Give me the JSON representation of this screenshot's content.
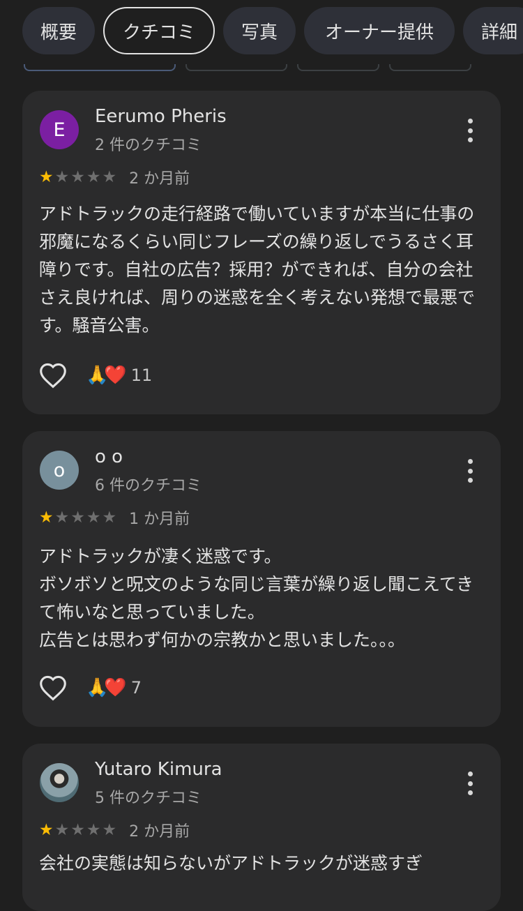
{
  "tabs": [
    {
      "label": "概要"
    },
    {
      "label": "クチコミ"
    },
    {
      "label": "写真"
    },
    {
      "label": "オーナー提供"
    },
    {
      "label": "詳細"
    }
  ],
  "reviews": [
    {
      "name": "Eerumo Pheris",
      "avatar_letter": "E",
      "avatar_color": "#7b1fa2",
      "review_count": "2 件のクチコミ",
      "rating": 1,
      "time": "2 か月前",
      "text": "アドトラックの走行経路で働いていますが本当に仕事の邪魔になるくらい同じフレーズの繰り返しでうるさく耳障りです。自社の広告？採用？ができれば、自分の会社さえ良ければ、周りの迷惑を全く考えない発想で最悪です。騒音公害。",
      "reactions": "🙏❤️",
      "reaction_count": "11"
    },
    {
      "name": "o o",
      "avatar_letter": "o",
      "avatar_color": "#78909c",
      "review_count": "6 件のクチコミ",
      "rating": 1,
      "time": "1 か月前",
      "text": "アドトラックが凄く迷惑です。\nボソボソと呪文のような同じ言葉が繰り返し聞こえてきて怖いなと思っていました。\n広告とは思わず何かの宗教かと思いました。。。",
      "reactions": "🙏❤️",
      "reaction_count": "7"
    },
    {
      "name": "Yutaro Kimura",
      "avatar_letter": "",
      "review_count": "5 件のクチコミ",
      "rating": 1,
      "time": "2 か月前",
      "text": "会社の実態は知らないがアドトラックが迷惑すぎ"
    }
  ],
  "icons": {
    "star": "★",
    "like": "heart-outline-icon",
    "more": "more-vert-icon"
  }
}
